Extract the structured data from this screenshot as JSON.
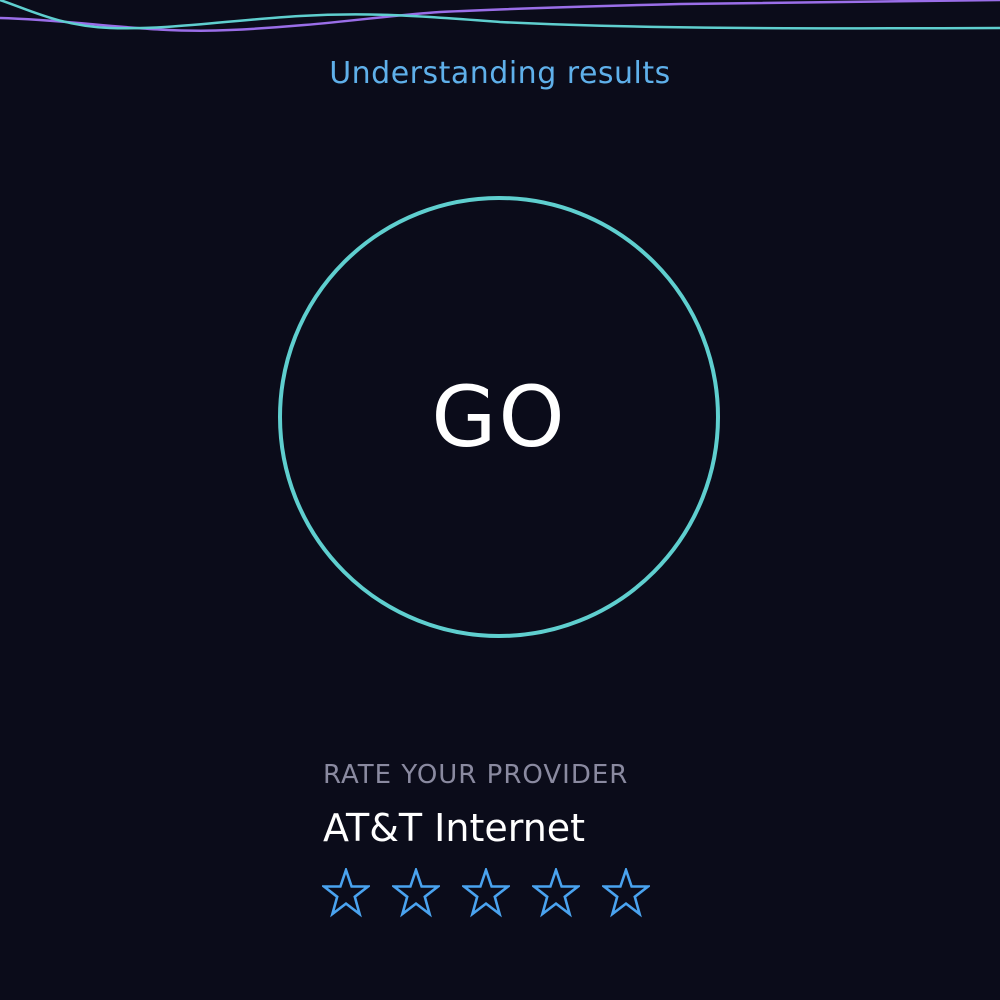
{
  "header": {
    "link_label": "Understanding results"
  },
  "test": {
    "go_label": "GO"
  },
  "rating": {
    "heading": "RATE YOUR PROVIDER",
    "provider": "AT&T Internet",
    "stars": [
      {
        "icon": "star-outline-icon",
        "filled": false
      },
      {
        "icon": "star-outline-icon",
        "filled": false
      },
      {
        "icon": "star-outline-icon",
        "filled": false
      },
      {
        "icon": "star-outline-icon",
        "filled": false
      },
      {
        "icon": "star-outline-icon",
        "filled": false
      }
    ]
  },
  "colors": {
    "background": "#0b0c1a",
    "accent_cyan": "#5fcfcf",
    "accent_purple": "#9a6ee8",
    "link_blue": "#5fb0ea",
    "star_blue": "#4aa3ef",
    "muted_text": "#8a8aa0"
  }
}
